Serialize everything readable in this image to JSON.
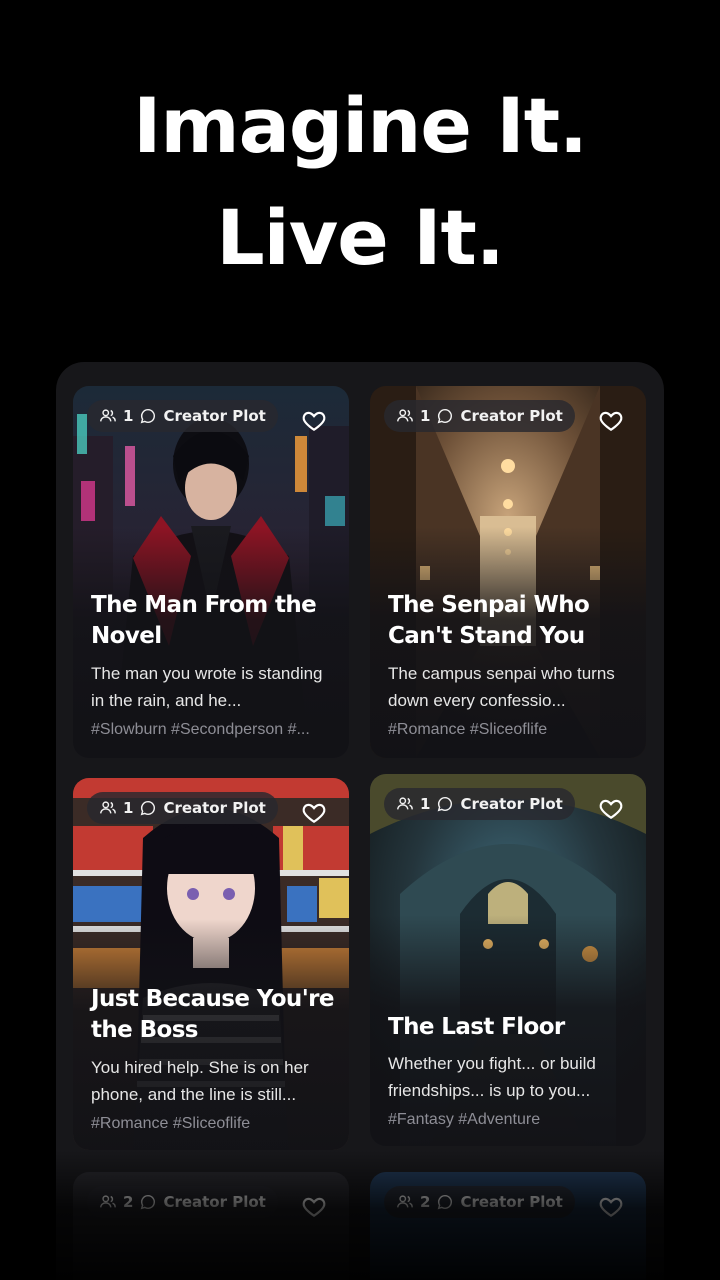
{
  "headline": {
    "line1": "Imagine It.",
    "line2": "Live It."
  },
  "cards": [
    {
      "players": "1",
      "tag_label": "Creator Plot",
      "title": "The Man From the Novel",
      "description": "The man you wrote is standing in the rain, and he...",
      "tags": "#Slowburn #Secondperson #...",
      "favorite_icon": "heart-outline"
    },
    {
      "players": "1",
      "tag_label": "Creator Plot",
      "title": "The Senpai Who Can't Stand You",
      "description": "The campus senpai who turns down every confessio...",
      "tags": "#Romance #Sliceoflife",
      "favorite_icon": "heart-outline"
    },
    {
      "players": "1",
      "tag_label": "Creator Plot",
      "title": "Just Because You're the Boss",
      "description": "You hired help. She is on her phone, and the line is still...",
      "tags": "#Romance #Sliceoflife",
      "favorite_icon": "heart-outline"
    },
    {
      "players": "1",
      "tag_label": "Creator Plot",
      "title": "The Last Floor",
      "description": "Whether you fight... or build friendships... is up to you...",
      "tags": "#Fantasy #Adventure",
      "favorite_icon": "heart-outline"
    },
    {
      "players": "2",
      "tag_label": "Creator Plot",
      "favorite_icon": "heart-outline"
    },
    {
      "players": "2",
      "tag_label": "Creator Plot",
      "favorite_icon": "heart-outline"
    }
  ],
  "colors": {
    "background": "#000000",
    "panel": "#17171a",
    "card_text": "#ffffff",
    "tag_text": "#8e8e96"
  }
}
